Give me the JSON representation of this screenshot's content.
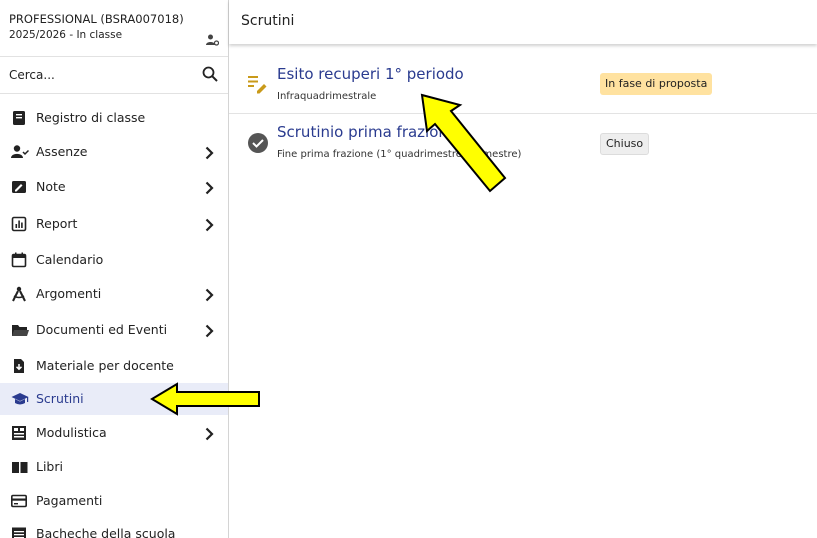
{
  "profile": {
    "line1": "PROFESSIONAL (BSRA007018)",
    "line2": "2025/2026 - In classe",
    "icon": "manage-account-icon"
  },
  "search": {
    "placeholder": "Cerca...",
    "icon": "search-icon"
  },
  "sidebar": {
    "items": [
      {
        "label": "Registro di classe",
        "icon": "book-icon",
        "chevron": false
      },
      {
        "label": "Assenze",
        "icon": "person-check-icon",
        "chevron": true
      },
      {
        "label": "Note",
        "icon": "note-icon",
        "chevron": true
      },
      {
        "label": "Report",
        "icon": "bar-chart-icon",
        "chevron": true
      },
      {
        "label": "Calendario",
        "icon": "calendar-icon",
        "chevron": false
      },
      {
        "label": "Argomenti",
        "icon": "compass-icon",
        "chevron": true
      },
      {
        "label": "Documenti ed Eventi",
        "icon": "folder-icon",
        "chevron": true
      },
      {
        "label": "Materiale per docente",
        "icon": "file-download-icon",
        "chevron": false
      },
      {
        "label": "Scrutini",
        "icon": "graduation-cap-icon",
        "chevron": false,
        "active": true
      },
      {
        "label": "Modulistica",
        "icon": "form-icon",
        "chevron": true
      },
      {
        "label": "Libri",
        "icon": "books-icon",
        "chevron": false
      },
      {
        "label": "Pagamenti",
        "icon": "credit-card-icon",
        "chevron": false
      },
      {
        "label": "Bacheche della scuola",
        "icon": "board-icon",
        "chevron": false
      }
    ]
  },
  "header": {
    "title": "Scrutini"
  },
  "scrutini": [
    {
      "title": "Esito recuperi 1° periodo",
      "subtitle": "Infraquadrimestrale",
      "status": "In fase di proposta",
      "icon": "edit-list-icon",
      "status_color": "#ffe2a0"
    },
    {
      "title": "Scrutinio prima frazione",
      "subtitle": "Fine prima frazione (1° quadrimestre / trimestre)",
      "status": "Chiuso",
      "icon": "check-circle-icon",
      "status_color": "#eeeeee"
    }
  ],
  "colors": {
    "accent": "#2a3b8f",
    "active_bg": "#e9ecf8",
    "arrow": "#ffff00"
  }
}
